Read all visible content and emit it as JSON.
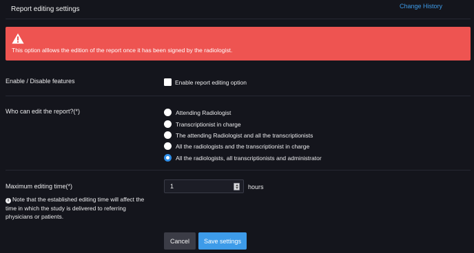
{
  "header": {
    "title": "Report editing settings",
    "change_history_link": "Change History"
  },
  "alert": {
    "icon": "warning-triangle-icon",
    "message": "This option alllows the edition of the report once it has been signed by the radiologist.",
    "color": "#ee5451"
  },
  "features": {
    "label": "Enable / Disable features",
    "checkbox_label": "Enable report editing option",
    "checked": false
  },
  "editors": {
    "label": "Who can edit the report?(*)",
    "options": [
      {
        "label": "Attending Radiologist",
        "selected": false
      },
      {
        "label": "Transcriptionist in charge",
        "selected": false
      },
      {
        "label": "The attending Radiologist and all the transcriptionists",
        "selected": false
      },
      {
        "label": "All the radiologists and the transcriptionist in charge",
        "selected": false
      },
      {
        "label": "All the radiologists, all transcriptionists and administrator",
        "selected": true
      }
    ]
  },
  "editing_time": {
    "label": "Maximum editing time(*)",
    "value": "1",
    "unit": "hours",
    "note_icon": "info-circle-icon",
    "note": "Note that the established editing time will affect the time in which the study is delivered to referring physicians or patients."
  },
  "actions": {
    "cancel_label": "Cancel",
    "save_label": "Save settings",
    "accent_color": "#3d9be9"
  }
}
